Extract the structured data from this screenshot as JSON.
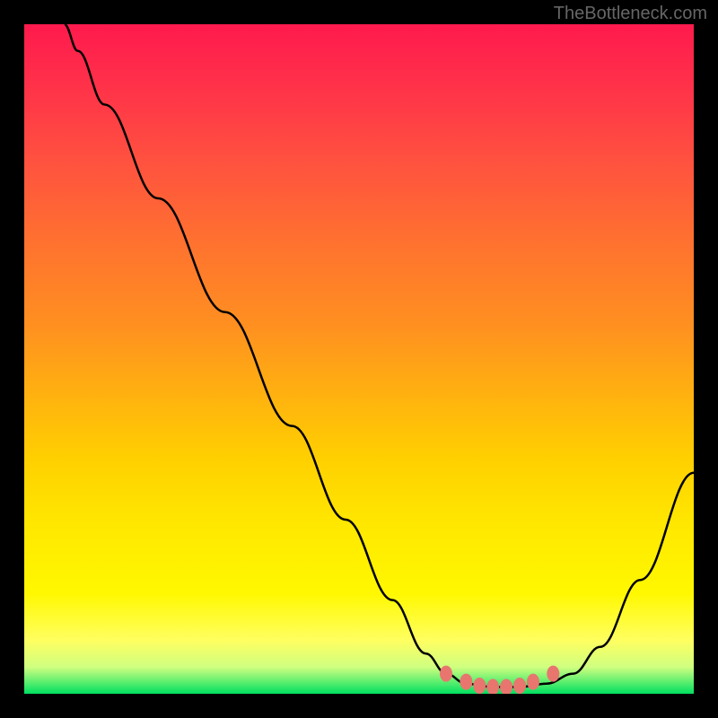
{
  "watermark": "TheBottleneck.com",
  "chart_data": {
    "type": "line",
    "title": "",
    "xlabel": "",
    "ylabel": "",
    "xlim": [
      0,
      100
    ],
    "ylim": [
      0,
      100
    ],
    "curve": [
      {
        "x": 6,
        "y": 100
      },
      {
        "x": 8,
        "y": 96
      },
      {
        "x": 12,
        "y": 88
      },
      {
        "x": 20,
        "y": 74
      },
      {
        "x": 30,
        "y": 57
      },
      {
        "x": 40,
        "y": 40
      },
      {
        "x": 48,
        "y": 26
      },
      {
        "x": 55,
        "y": 14
      },
      {
        "x": 60,
        "y": 6
      },
      {
        "x": 63,
        "y": 3
      },
      {
        "x": 66,
        "y": 1.5
      },
      {
        "x": 70,
        "y": 1
      },
      {
        "x": 74,
        "y": 1
      },
      {
        "x": 78,
        "y": 1.5
      },
      {
        "x": 82,
        "y": 3
      },
      {
        "x": 86,
        "y": 7
      },
      {
        "x": 92,
        "y": 17
      },
      {
        "x": 100,
        "y": 33
      }
    ],
    "highlight_points": [
      {
        "x": 63,
        "y": 3
      },
      {
        "x": 66,
        "y": 1.8
      },
      {
        "x": 68,
        "y": 1.2
      },
      {
        "x": 70,
        "y": 1
      },
      {
        "x": 72,
        "y": 1
      },
      {
        "x": 74,
        "y": 1.2
      },
      {
        "x": 76,
        "y": 1.8
      },
      {
        "x": 79,
        "y": 3
      }
    ],
    "gradient_stops": [
      {
        "pos": 0,
        "color": "#ff1a4d"
      },
      {
        "pos": 50,
        "color": "#ffb000"
      },
      {
        "pos": 90,
        "color": "#ffff40"
      },
      {
        "pos": 100,
        "color": "#00e060"
      }
    ]
  }
}
